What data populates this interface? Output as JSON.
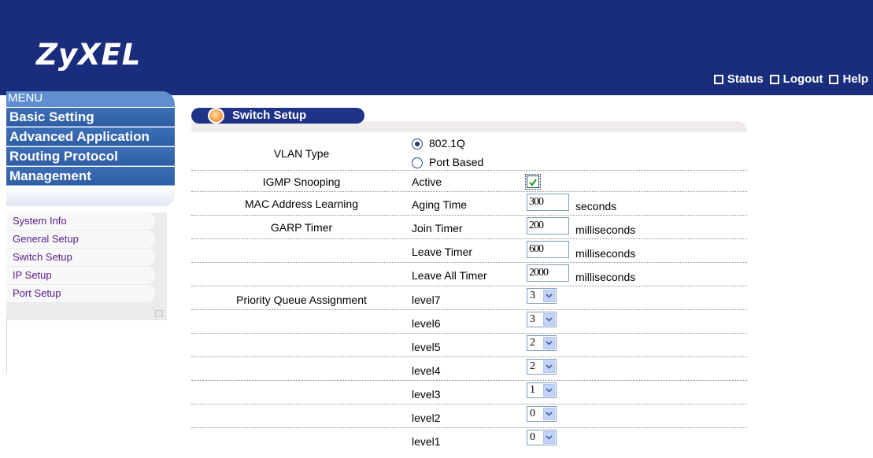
{
  "header": {
    "logo": "ZyXEL",
    "links": [
      {
        "label": "Status",
        "icon": "home-icon"
      },
      {
        "label": "Logout",
        "icon": "logout-icon"
      },
      {
        "label": "Help",
        "icon": "help-icon"
      }
    ]
  },
  "menu": {
    "title": "MENU",
    "buttons": [
      "Basic Setting",
      "Advanced Application",
      "Routing Protocol",
      "Management"
    ],
    "subitems": [
      "System Info",
      "General Setup",
      "Switch Setup",
      "IP Setup",
      "Port Setup"
    ]
  },
  "page": {
    "title": "Switch Setup"
  },
  "form": {
    "vlan_type": {
      "label": "VLAN Type",
      "options": [
        "802.1Q",
        "Port Based"
      ],
      "selected": "802.1Q"
    },
    "igmp": {
      "label": "IGMP Snooping",
      "field": "Active",
      "checked": true
    },
    "mac": {
      "label": "MAC Address Learning",
      "field": "Aging Time",
      "value": "300",
      "unit": "seconds"
    },
    "garp": {
      "label": "GARP Timer",
      "rows": [
        {
          "field": "Join Timer",
          "value": "200",
          "unit": "milliseconds"
        },
        {
          "field": "Leave Timer",
          "value": "600",
          "unit": "milliseconds"
        },
        {
          "field": "Leave All Timer",
          "value": "2000",
          "unit": "milliseconds"
        }
      ]
    },
    "priority": {
      "label": "Priority Queue Assignment",
      "levels": [
        {
          "level": "level7",
          "value": "3"
        },
        {
          "level": "level6",
          "value": "3"
        },
        {
          "level": "level5",
          "value": "2"
        },
        {
          "level": "level4",
          "value": "2"
        },
        {
          "level": "level3",
          "value": "1"
        },
        {
          "level": "level2",
          "value": "0"
        },
        {
          "level": "level1",
          "value": "0"
        }
      ]
    }
  },
  "colors": {
    "header": "#1a2d7c",
    "menu_button": "#3d6fb6",
    "submenu_link": "#551a8b"
  }
}
